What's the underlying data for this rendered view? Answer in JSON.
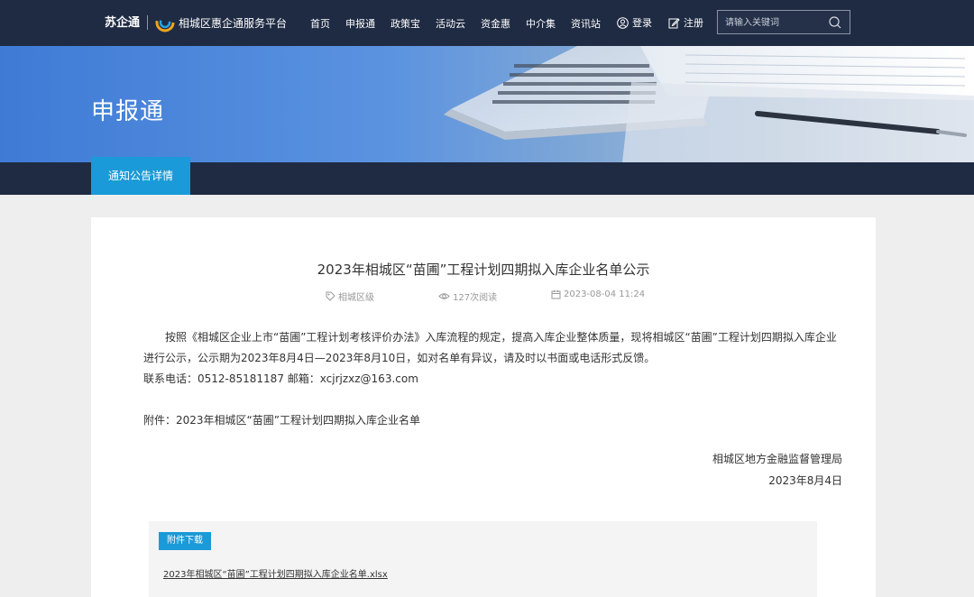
{
  "header": {
    "logo_mark": "苏企通",
    "platform_name": "相城区惠企通服务平台",
    "nav": [
      "首页",
      "申报通",
      "政策宝",
      "活动云",
      "资金惠",
      "中介集",
      "资讯站"
    ],
    "login_label": "登录",
    "register_label": "注册",
    "search_placeholder": "请输入关键词"
  },
  "banner": {
    "title": "申报通"
  },
  "subnav": {
    "tab_label": "通知公告详情"
  },
  "article": {
    "title": "2023年相城区“苗圃”工程计划四期拟入库企业名单公示",
    "meta": {
      "region": "相城区级",
      "views": "127次阅读",
      "date": "2023-08-04 11:24"
    },
    "paragraph1": "按照《相城区企业上市“苗圃”工程计划考核评价办法》入库流程的规定，提高入库企业整体质量，现将相城区“苗圃”工程计划四期拟入库企业进行公示，公示期为2023年8月4日—2023年8月10日，如对名单有异议，请及时以书面或电话形式反馈。",
    "contact": "联系电话：0512-85181187  邮箱：xcjrjzxz@163.com",
    "attachment_note": "附件：2023年相城区“苗圃”工程计划四期拟入库企业名单",
    "signature_org": "相城区地方金融监督管理局",
    "signature_date": "2023年8月4日"
  },
  "attachments": {
    "label": "附件下载",
    "file_name": "2023年相城区“苗圃”工程计划四期拟入库企业名单.xlsx"
  },
  "colors": {
    "nav_bg": "#1f2b43",
    "accent": "#1a9ad8",
    "banner_blue": "#3f7bd6"
  }
}
